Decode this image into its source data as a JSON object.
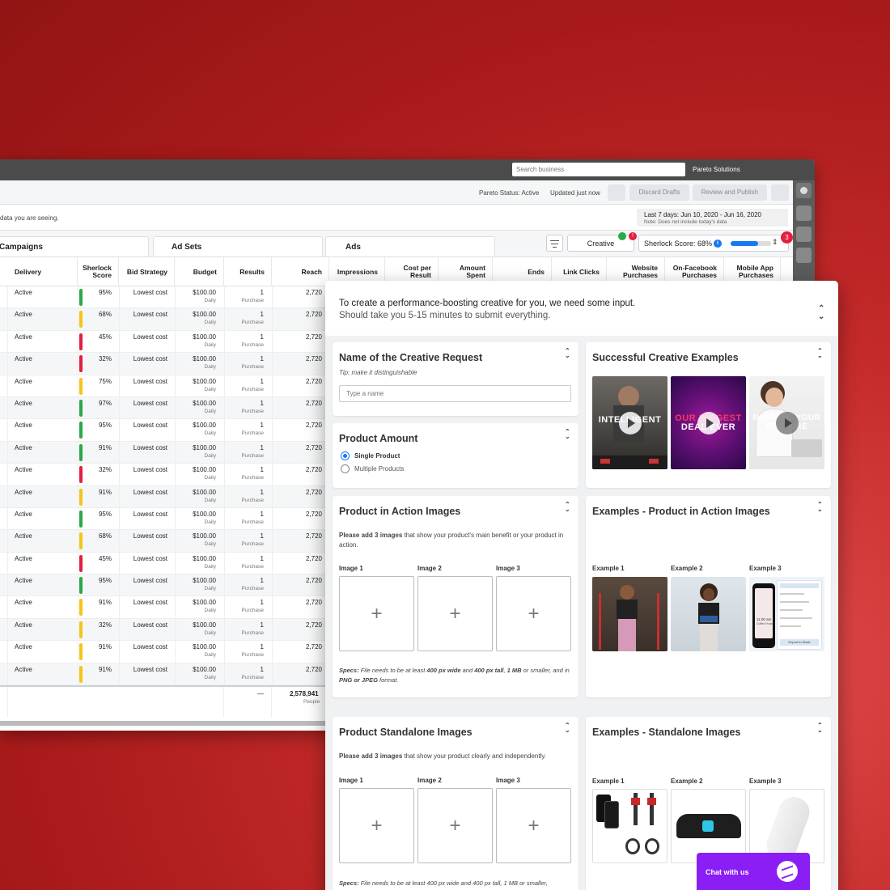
{
  "topbar": {
    "search_placeholder": "Search business",
    "account_name": "Pareto Solutions"
  },
  "statusbar": {
    "pareto_status": "Pareto Status: Active",
    "updated": "Updated just now",
    "discard_label": "Discard Drafts",
    "review_label": "Review and Publish"
  },
  "infobar": {
    "partial_text": "data you are seeing.",
    "date_range": "Last 7 days: Jun 10, 2020 - Jun 16, 2020",
    "date_note": "Note: Does not include today's data"
  },
  "tabs": {
    "campaigns": "Campaigns",
    "adsets": "Ad Sets",
    "ads": "Ads"
  },
  "toolbar": {
    "creative_label": "Creative",
    "creative_badge": "!",
    "sherlock_label": "Sherlock Score: 68%",
    "sherlock_info": "i",
    "sherlock_score": 0.68,
    "notification_count": "3"
  },
  "columns": {
    "delivery": "Delivery",
    "sherlock": "Sherlock Score",
    "bid": "Bid Strategy",
    "budget": "Budget",
    "results": "Results",
    "reach": "Reach",
    "impressions": "Impressions",
    "cpr": "Cost per Result",
    "amount": "Amount Spent",
    "ends": "Ends",
    "link_clicks": "Link Clicks",
    "website": "Website Purchases",
    "onfb": "On-Facebook Purchases",
    "mobile": "Mobile App Purchases"
  },
  "colors": {
    "green": "#2ba84a",
    "yellow": "#f5c518",
    "red": "#e41e3f",
    "accent": "#1877f2",
    "chat": "#8a1ef5"
  },
  "rows": [
    {
      "delivery": "Active",
      "score": "95%",
      "color": "green",
      "bid": "Lowest cost",
      "budget": "$100.00",
      "budget_sub": "Daily",
      "results": "1",
      "results_sub": "Purchase",
      "reach": "2,720"
    },
    {
      "delivery": "Active",
      "score": "68%",
      "color": "yellow",
      "bid": "Lowest cost",
      "budget": "$100.00",
      "budget_sub": "Daily",
      "results": "1",
      "results_sub": "Purchase",
      "reach": "2,720"
    },
    {
      "delivery": "Active",
      "score": "45%",
      "color": "red",
      "bid": "Lowest cost",
      "budget": "$100.00",
      "budget_sub": "Daily",
      "results": "1",
      "results_sub": "Purchase",
      "reach": "2,720"
    },
    {
      "delivery": "Active",
      "score": "32%",
      "color": "red",
      "bid": "Lowest cost",
      "budget": "$100.00",
      "budget_sub": "Daily",
      "results": "1",
      "results_sub": "Purchase",
      "reach": "2,720"
    },
    {
      "delivery": "Active",
      "score": "75%",
      "color": "yellow",
      "bid": "Lowest cost",
      "budget": "$100.00",
      "budget_sub": "Daily",
      "results": "1",
      "results_sub": "Purchase",
      "reach": "2,720"
    },
    {
      "delivery": "Active",
      "score": "97%",
      "color": "green",
      "bid": "Lowest cost",
      "budget": "$100.00",
      "budget_sub": "Daily",
      "results": "1",
      "results_sub": "Purchase",
      "reach": "2,720"
    },
    {
      "delivery": "Active",
      "score": "95%",
      "color": "green",
      "bid": "Lowest cost",
      "budget": "$100.00",
      "budget_sub": "Daily",
      "results": "1",
      "results_sub": "Purchase",
      "reach": "2,720"
    },
    {
      "delivery": "Active",
      "score": "91%",
      "color": "green",
      "bid": "Lowest cost",
      "budget": "$100.00",
      "budget_sub": "Daily",
      "results": "1",
      "results_sub": "Purchase",
      "reach": "2,720"
    },
    {
      "delivery": "Active",
      "score": "32%",
      "color": "red",
      "bid": "Lowest cost",
      "budget": "$100.00",
      "budget_sub": "Daily",
      "results": "1",
      "results_sub": "Purchase",
      "reach": "2,720"
    },
    {
      "delivery": "Active",
      "score": "91%",
      "color": "yellow",
      "bid": "Lowest cost",
      "budget": "$100.00",
      "budget_sub": "Daily",
      "results": "1",
      "results_sub": "Purchase",
      "reach": "2,720"
    },
    {
      "delivery": "Active",
      "score": "95%",
      "color": "green",
      "bid": "Lowest cost",
      "budget": "$100.00",
      "budget_sub": "Daily",
      "results": "1",
      "results_sub": "Purchase",
      "reach": "2,720"
    },
    {
      "delivery": "Active",
      "score": "68%",
      "color": "yellow",
      "bid": "Lowest cost",
      "budget": "$100.00",
      "budget_sub": "Daily",
      "results": "1",
      "results_sub": "Purchase",
      "reach": "2,720"
    },
    {
      "delivery": "Active",
      "score": "45%",
      "color": "red",
      "bid": "Lowest cost",
      "budget": "$100.00",
      "budget_sub": "Daily",
      "results": "1",
      "results_sub": "Purchase",
      "reach": "2,720"
    },
    {
      "delivery": "Active",
      "score": "95%",
      "color": "green",
      "bid": "Lowest cost",
      "budget": "$100.00",
      "budget_sub": "Daily",
      "results": "1",
      "results_sub": "Purchase",
      "reach": "2,720"
    },
    {
      "delivery": "Active",
      "score": "91%",
      "color": "yellow",
      "bid": "Lowest cost",
      "budget": "$100.00",
      "budget_sub": "Daily",
      "results": "1",
      "results_sub": "Purchase",
      "reach": "2,720"
    },
    {
      "delivery": "Active",
      "score": "32%",
      "color": "yellow",
      "bid": "Lowest cost",
      "budget": "$100.00",
      "budget_sub": "Daily",
      "results": "1",
      "results_sub": "Purchase",
      "reach": "2,720"
    },
    {
      "delivery": "Active",
      "score": "91%",
      "color": "yellow",
      "bid": "Lowest cost",
      "budget": "$100.00",
      "budget_sub": "Daily",
      "results": "1",
      "results_sub": "Purchase",
      "reach": "2,720"
    },
    {
      "delivery": "Active",
      "score": "91%",
      "color": "yellow",
      "bid": "Lowest cost",
      "budget": "$100.00",
      "budget_sub": "Daily",
      "results": "1",
      "results_sub": "Purchase",
      "reach": "2,720"
    }
  ],
  "totals": {
    "results": "—",
    "reach": "2,578,941",
    "reach_sub": "People"
  },
  "panel": {
    "title": "To create a performance-boosting creative for you, we need some input.",
    "subtitle": "Should take you 5-15 minutes to submit everything.",
    "collapse_glyph": "⌃⌄",
    "name_card": {
      "title": "Name of the Creative Request",
      "tip": "Tip: make it distinguishable",
      "placeholder": "Type a name"
    },
    "amount_card": {
      "title": "Product Amount",
      "single": "Single Product",
      "multiple": "Multiple Products"
    },
    "success_card": {
      "title": "Successful Creative Examples",
      "video1": "INTELLIGENT",
      "video2_line1": "OUR BIGGEST",
      "video2_line2": "DEAL EVER",
      "video3": "IMPROVE YOUR POSTURE"
    },
    "action_card": {
      "title": "Product in Action Images",
      "desc_bold": "Please add 3 images",
      "desc_rest": " that show your product's main benefit or your product in action.",
      "image1": "Image 1",
      "image2": "Image 2",
      "image3": "Image 3",
      "plus": "+",
      "specs_label": "Specs:",
      "specs_a": " File needs to be at least ",
      "specs_w": "400 px wide",
      "specs_b": " and ",
      "specs_h": "400 px tall",
      "specs_c": ", ",
      "specs_mb": "1 MB",
      "specs_d": " or smaller, and in ",
      "specs_fmt": "PNG or JPEG",
      "specs_e": " format."
    },
    "action_examples": {
      "title": "Examples - Product in Action Images",
      "ex1": "Example 1",
      "ex2": "Example 2",
      "ex3": "Example 3",
      "phone_time": "11:00 am",
      "phone_place": "Coffee House",
      "export_btn": "Export to Slack"
    },
    "standalone_card": {
      "title": "Product Standalone Images",
      "desc_bold": "Please add 3 images",
      "desc_rest": " that show your product clearly and independently.",
      "image1": "Image 1",
      "image2": "Image 2",
      "image3": "Image 3",
      "plus": "+",
      "specs_label": "Specs:",
      "specs_text": " File needs to be at least 400 px wide and 400 px tall, 1 MB or smaller,"
    },
    "standalone_examples": {
      "title": "Examples - Standalone Images",
      "ex1": "Example 1",
      "ex2": "Example 2",
      "ex3": "Example 3"
    }
  },
  "chat": {
    "label": "Chat with us"
  }
}
